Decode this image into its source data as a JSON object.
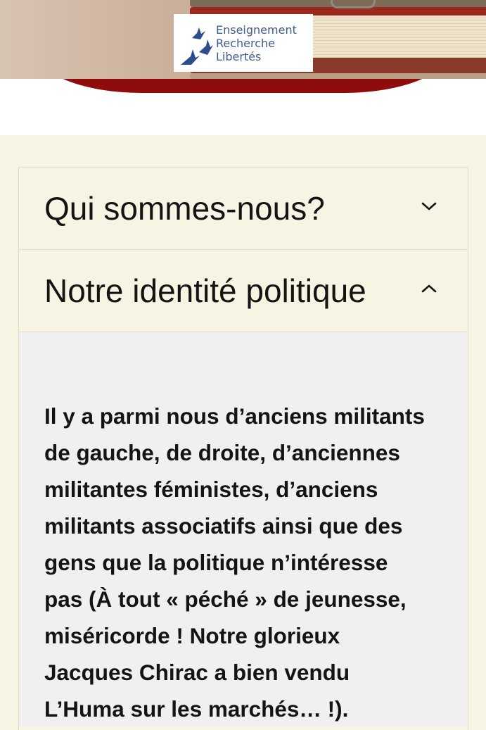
{
  "logo": {
    "lines": [
      "Enseignement",
      "Recherche",
      "Libertés"
    ],
    "color": "#3f5d8f"
  },
  "accordion": {
    "items": [
      {
        "title": "Qui sommes-nous?",
        "expanded": false,
        "icon": "chevron-down-icon"
      },
      {
        "title": "Notre identité politique",
        "expanded": true,
        "icon": "chevron-up-icon"
      }
    ],
    "panel_lines": [
      "Il y a parmi nous d’anciens militants",
      "de gauche, de droite, d’anciennes",
      "militantes féministes, d’anciens",
      "militants associatifs ainsi que des",
      "gens que la politique n’intéresse",
      "pas (À tout « péché » de jeunesse,",
      "miséricorde ! Notre glorieux",
      "Jacques Chirac a bien vendu",
      "L’Huma sur les marchés… !)."
    ]
  },
  "colors": {
    "page_background": "#f8f4e4",
    "panel_background": "#f1f0ef",
    "accent_red": "#8e0c0c",
    "text": "#141414"
  }
}
